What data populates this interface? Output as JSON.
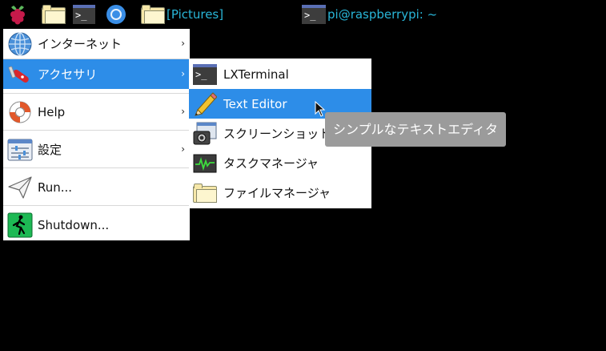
{
  "taskbar": {
    "icons": [
      "raspberry-icon",
      "folder-icon",
      "terminal-icon",
      "chromium-icon"
    ],
    "items": [
      {
        "label": "[Pictures]",
        "icon": "folder-icon"
      },
      {
        "label": "pi@raspberrypi: ~",
        "icon": "terminal-icon"
      }
    ],
    "label_color": "#29b6d8"
  },
  "main_menu": {
    "items": [
      {
        "label": "インターネット",
        "icon": "globe-icon",
        "submenu": true
      },
      {
        "label": "アクセサリ",
        "icon": "knife-icon",
        "submenu": true,
        "selected": true
      },
      {
        "label": "Help",
        "icon": "lifebuoy-icon",
        "submenu": true
      },
      {
        "label": "設定",
        "icon": "settings-icon",
        "submenu": true
      },
      {
        "label": "Run...",
        "icon": "paper-plane-icon",
        "submenu": false
      },
      {
        "label": "Shutdown...",
        "icon": "exit-icon",
        "submenu": false
      }
    ],
    "arrow": "›"
  },
  "sub_menu": {
    "items": [
      {
        "label": "LXTerminal",
        "icon": "terminal-icon"
      },
      {
        "label": "Text Editor",
        "icon": "pencil-icon",
        "selected": true
      },
      {
        "label": "スクリーンショット",
        "icon": "screenshot-icon"
      },
      {
        "label": "タスクマネージャ",
        "icon": "task-manager-icon"
      },
      {
        "label": "ファイルマネージャ",
        "icon": "folder-icon"
      }
    ]
  },
  "tooltip": {
    "text": "シンプルなテキストエディタ"
  },
  "colors": {
    "selection": "#2d8de8",
    "background": "#000000",
    "tooltip": "#9b9b9b"
  }
}
